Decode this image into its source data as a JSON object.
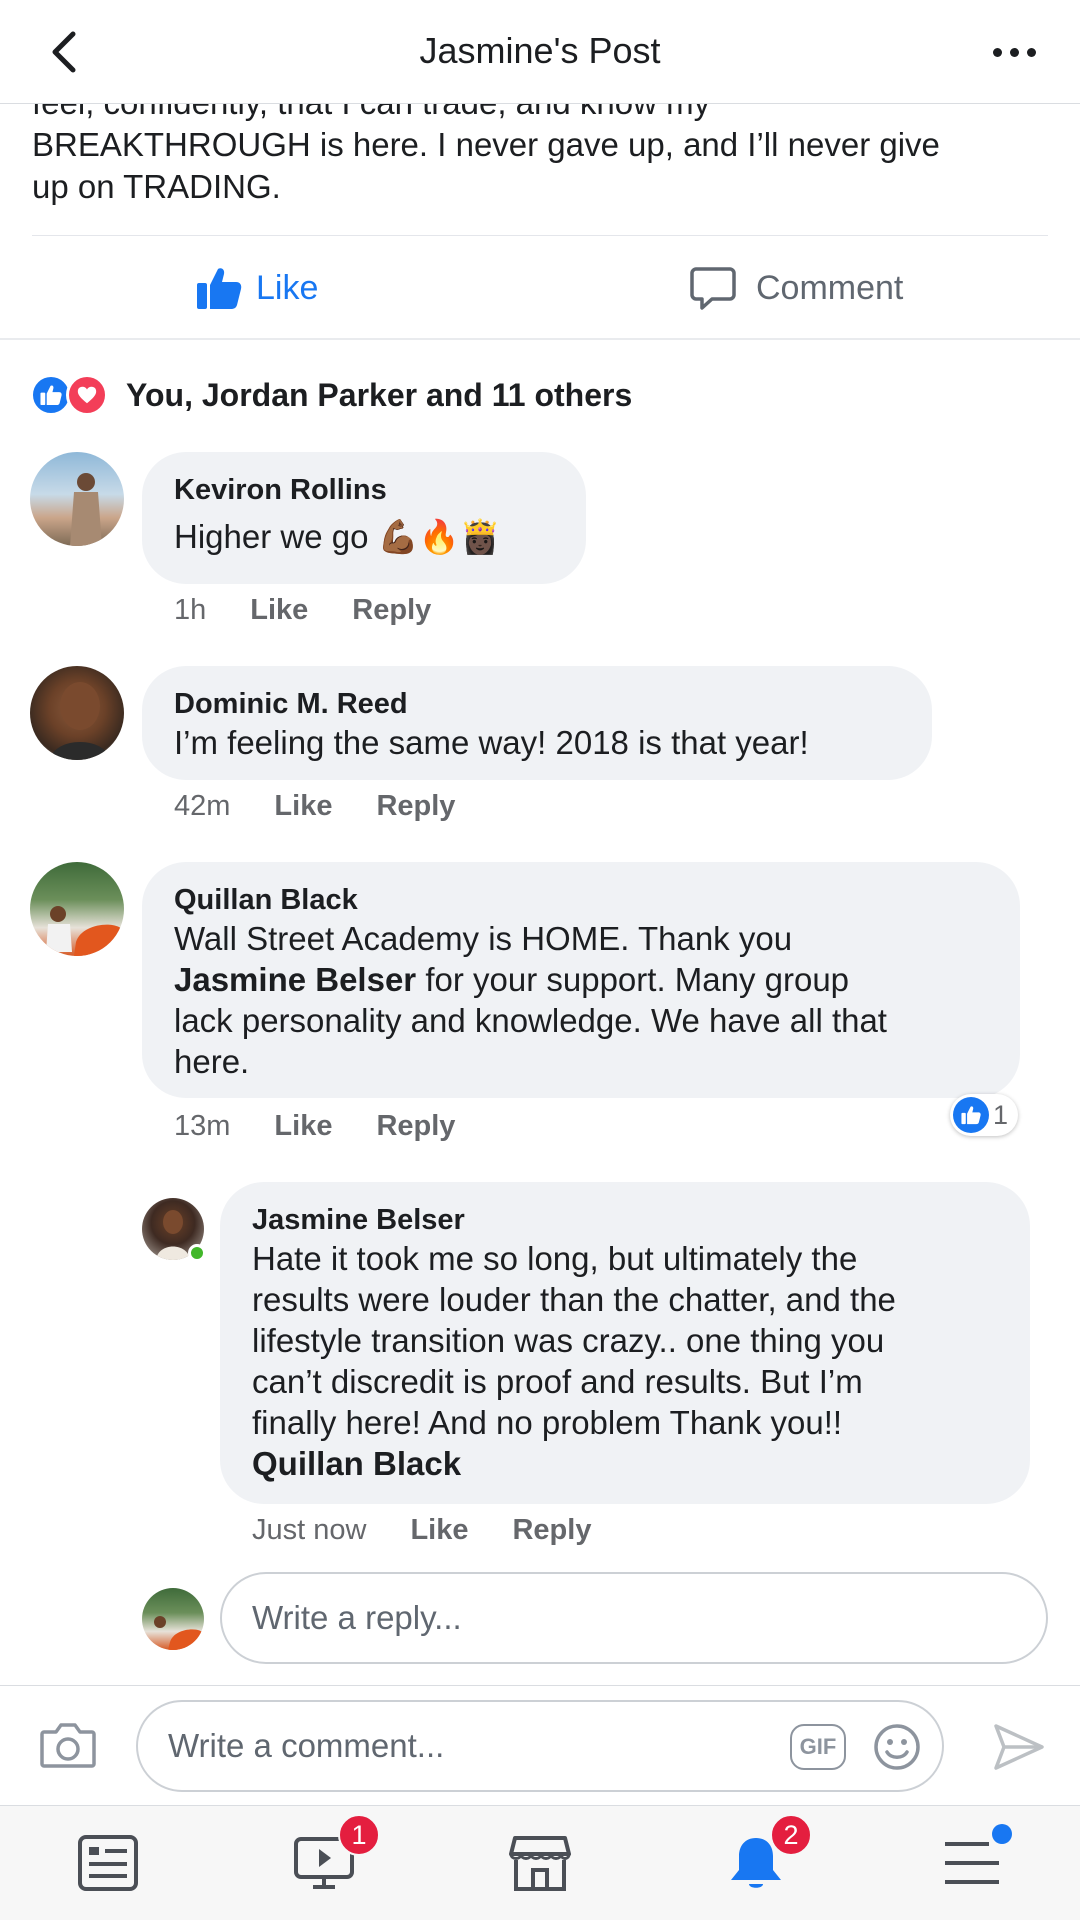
{
  "header": {
    "title": "Jasmine's Post"
  },
  "post": {
    "cut_line": "feel, confidently, that I can trade, and know my",
    "text_line_1": "BREAKTHROUGH is here. I never gave up, and I’ll never give",
    "text_line_2": "up on TRADING."
  },
  "actions": {
    "like_label": "Like",
    "comment_label": "Comment",
    "accent": "#1877f2"
  },
  "reactions": {
    "summary": "You, Jordan Parker and 11 others"
  },
  "comments": [
    {
      "author": "Keviron Rollins",
      "text": "Higher we go 💪🏾🔥👸🏿",
      "time": "1h",
      "like": "Like",
      "reply": "Reply"
    },
    {
      "author": "Dominic M. Reed",
      "text": "I’m feeling the same way! 2018 is that year!",
      "time": "42m",
      "like": "Like",
      "reply": "Reply"
    },
    {
      "author": "Quillan Black",
      "text_1": "Wall Street Academy is HOME. Thank you",
      "mention": "Jasmine Belser",
      "text_2": " for your support. Many group",
      "text_3": "lack personality and knowledge. We have all that",
      "text_4": "here.",
      "time": "13m",
      "like": "Like",
      "reply": "Reply",
      "like_count": "1"
    }
  ],
  "reply": {
    "author": "Jasmine Belser",
    "lines": [
      "Hate it took me so long, but ultimately the",
      "results were louder than the chatter, and the",
      "lifestyle transition was crazy.. one thing you",
      "can’t discredit is proof and results. But I’m",
      "finally here! And no problem Thank you!!"
    ],
    "mention": "Quillan Black",
    "time": "Just now",
    "like": "Like",
    "reply": "Reply"
  },
  "reply_box": {
    "placeholder": "Write a reply..."
  },
  "composer": {
    "placeholder": "Write a comment...",
    "gif_label": "GIF"
  },
  "tabbar": {
    "items": [
      "news-feed",
      "watch",
      "marketplace",
      "notifications",
      "menu"
    ],
    "watch_badge": "1",
    "notifications_badge": "2"
  }
}
